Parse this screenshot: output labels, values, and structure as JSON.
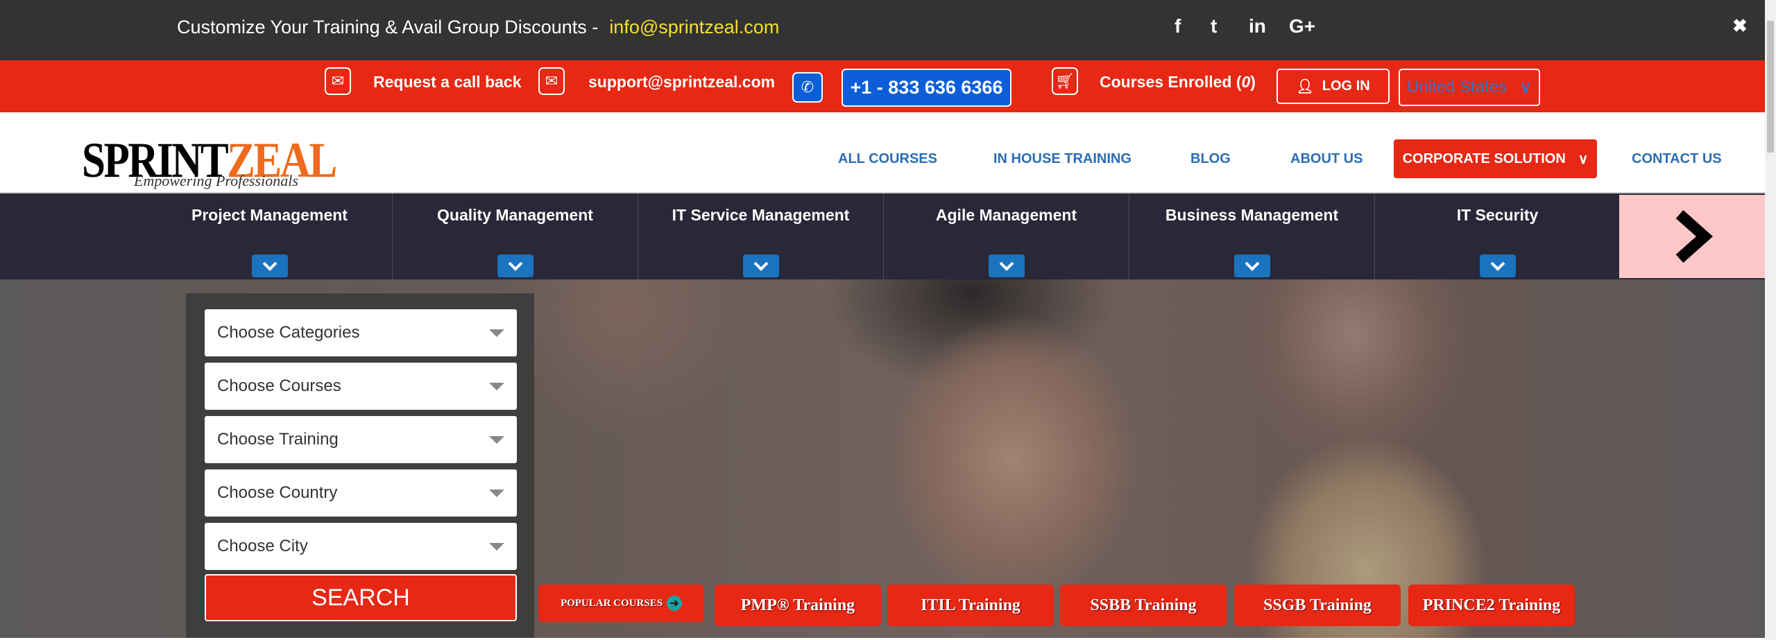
{
  "topbar": {
    "promo": "Customize Your Training & Avail Group Discounts -",
    "email": "info@sprintzeal.com",
    "social": [
      {
        "icon": "facebook-icon",
        "glyph": "f"
      },
      {
        "icon": "twitter-icon",
        "glyph": "t"
      },
      {
        "icon": "linkedin-icon",
        "glyph": "in"
      },
      {
        "icon": "google-plus-icon",
        "glyph": "G+"
      }
    ],
    "close": "✖"
  },
  "contactbar": {
    "callback": "Request a call back",
    "support_email": "support@sprintzeal.com",
    "phone": "+1 - 833 636 6366",
    "courses_enrolled": "Courses Enrolled",
    "enrolled_count": "0",
    "login": "LOG IN",
    "country": "United States"
  },
  "logo": {
    "part1": "SPRINT",
    "part2": "ZEAL",
    "tagline": "Empowering Professionals"
  },
  "nav": {
    "links": [
      "ALL COURSES",
      "IN HOUSE TRAINING",
      "BLOG",
      "ABOUT US"
    ],
    "corporate": "CORPORATE SOLUTION",
    "contact": "CONTACT US"
  },
  "categories": [
    "Project Management",
    "Quality Management",
    "IT Service Management",
    "Agile Management",
    "Business Management",
    "IT Security"
  ],
  "search": {
    "selects": [
      "Choose Categories",
      "Choose Courses",
      "Choose Training",
      "Choose Country",
      "Choose City"
    ],
    "button": "SEARCH"
  },
  "popular": {
    "label": "POPULAR COURSES",
    "courses": [
      "PMP® Training",
      "ITIL Training",
      "SSBB Training",
      "SSGB Training",
      "PRINCE2 Training"
    ]
  },
  "colors": {
    "brand_red": "#e62814",
    "nav_blue": "#2a6db5",
    "dark_bar": "#333333",
    "category_bar": "#282839",
    "accent_yellow": "#f5e12b"
  }
}
